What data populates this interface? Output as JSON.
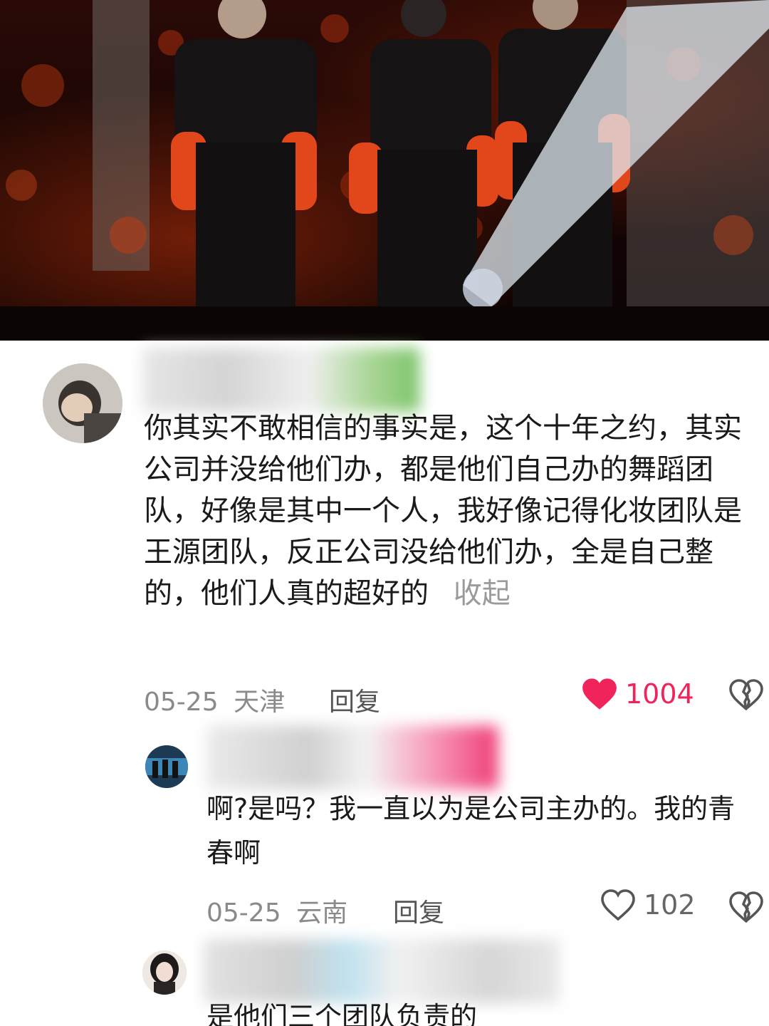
{
  "comments": [
    {
      "text": "你其实不敢相信的事实是，这个十年之约，其实公司并没给他们办，都是他们自己办的舞蹈团队，好像是其中一个人，我好像记得化妆团队是王源团队，反正公司没给他们办，全是自己整的，他们人真的超好的",
      "collapse_label": "收起",
      "date": "05-25",
      "location": "天津",
      "reply_label": "回复",
      "like_count": "1004",
      "liked": true
    },
    {
      "text": "啊?是吗？我一直以为是公司主办的。我的青春啊",
      "date": "05-25",
      "location": "云南",
      "reply_label": "回复",
      "like_count": "102",
      "liked": false
    },
    {
      "text": "是他们三个团队负责的"
    }
  ],
  "colors": {
    "like_active": "#f0245a",
    "text": "#1a1a1a",
    "meta": "#8a8a8a",
    "collapse": "#9a9a9a"
  },
  "icons": {
    "like_filled": "heart-filled-icon",
    "like_outline": "heart-outline-icon",
    "dislike": "broken-heart-icon"
  }
}
